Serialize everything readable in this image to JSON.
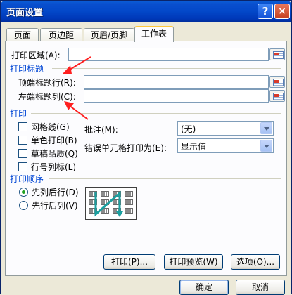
{
  "window": {
    "title": "页面设置",
    "help_icon": "?",
    "close_icon": "×"
  },
  "tabs": [
    {
      "label": "页面",
      "active": false
    },
    {
      "label": "页边距",
      "active": false
    },
    {
      "label": "页眉/页脚",
      "active": false
    },
    {
      "label": "工作表",
      "active": true
    }
  ],
  "print_area": {
    "label": "打印区域(A):",
    "value": ""
  },
  "print_titles": {
    "group": "打印标题",
    "top_rows_label": "顶端标题行(R):",
    "top_rows_value": "",
    "left_cols_label": "左端标题列(C):",
    "left_cols_value": ""
  },
  "print": {
    "group": "打印",
    "checkboxes": [
      {
        "label": "网格线(G)",
        "checked": false
      },
      {
        "label": "单色打印(B)",
        "checked": false
      },
      {
        "label": "草稿品质(Q)",
        "checked": false
      },
      {
        "label": "行号列标(L)",
        "checked": false
      }
    ],
    "comments_label": "批注(M):",
    "comments_value": "(无)",
    "errors_label": "错误单元格打印为(E):",
    "errors_value": "显示值"
  },
  "order": {
    "group": "打印顺序",
    "options": [
      {
        "label": "先列后行(D)",
        "selected": true
      },
      {
        "label": "先行后列(V)",
        "selected": false
      }
    ]
  },
  "buttons": {
    "print": "打印(P)...",
    "preview": "打印预览(W)",
    "options": "选项(O)...",
    "ok": "确定",
    "cancel": "取消"
  },
  "colors": {
    "title_bar": "#0348c9",
    "annotation_arrow": "#ff2020",
    "order_arrow": "#1aa0a0"
  }
}
